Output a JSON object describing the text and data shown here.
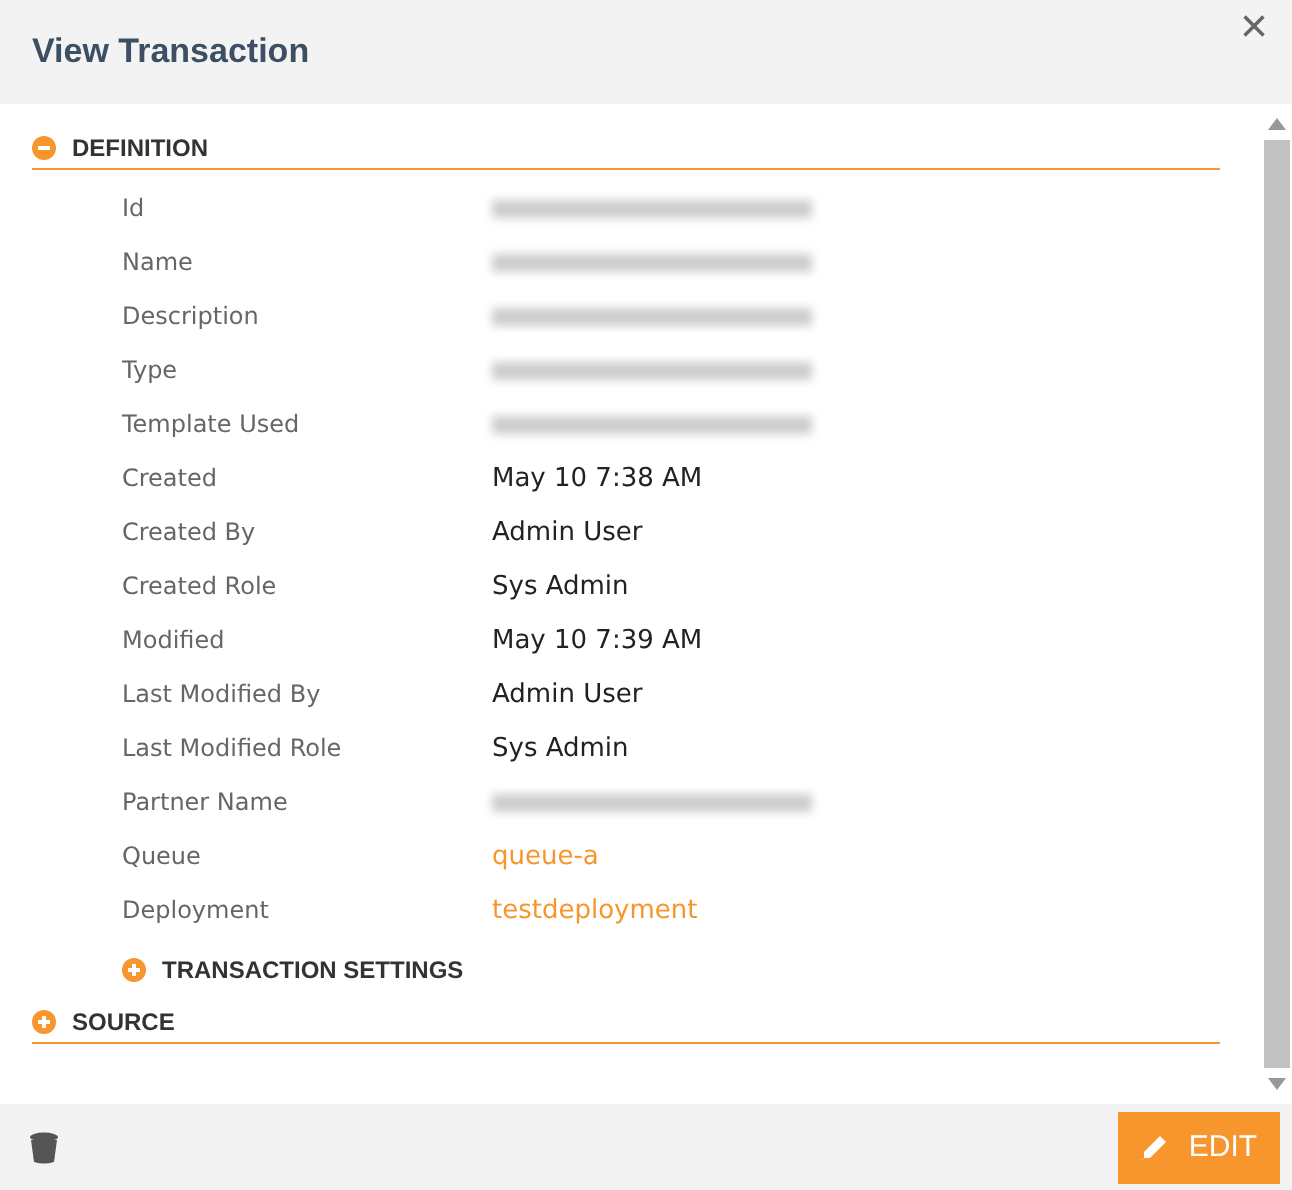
{
  "window": {
    "title": "View Transaction",
    "close": "×"
  },
  "sections": [
    {
      "title": "DEFINITION",
      "expanded": true,
      "fields": [
        {
          "label": "Id",
          "kind": "redacted"
        },
        {
          "label": "Name",
          "kind": "redacted"
        },
        {
          "label": "Description",
          "kind": "redacted"
        },
        {
          "label": "Type",
          "kind": "redacted"
        },
        {
          "label": "Template Used",
          "kind": "redacted"
        },
        {
          "label": "Created",
          "kind": "text",
          "value": "May 10 7:38 AM"
        },
        {
          "label": "Created By",
          "kind": "text",
          "value": "Admin User"
        },
        {
          "label": "Created Role",
          "kind": "text",
          "value": "Sys Admin"
        },
        {
          "label": "Modified",
          "kind": "text",
          "value": "May 10 7:39 AM"
        },
        {
          "label": "Last Modified By",
          "kind": "text",
          "value": "Admin User"
        },
        {
          "label": "Last Modified Role",
          "kind": "text",
          "value": "Sys Admin"
        },
        {
          "label": "Partner Name",
          "kind": "redacted"
        },
        {
          "label": "Queue",
          "kind": "link",
          "value": "queue-a"
        },
        {
          "label": "Deployment",
          "kind": "link",
          "value": "testdeployment"
        }
      ],
      "subsections": [
        {
          "title": "TRANSACTION SETTINGS",
          "expanded": false
        }
      ]
    },
    {
      "title": "SOURCE",
      "expanded": false
    }
  ],
  "footer": {
    "edit_label": "EDIT"
  }
}
